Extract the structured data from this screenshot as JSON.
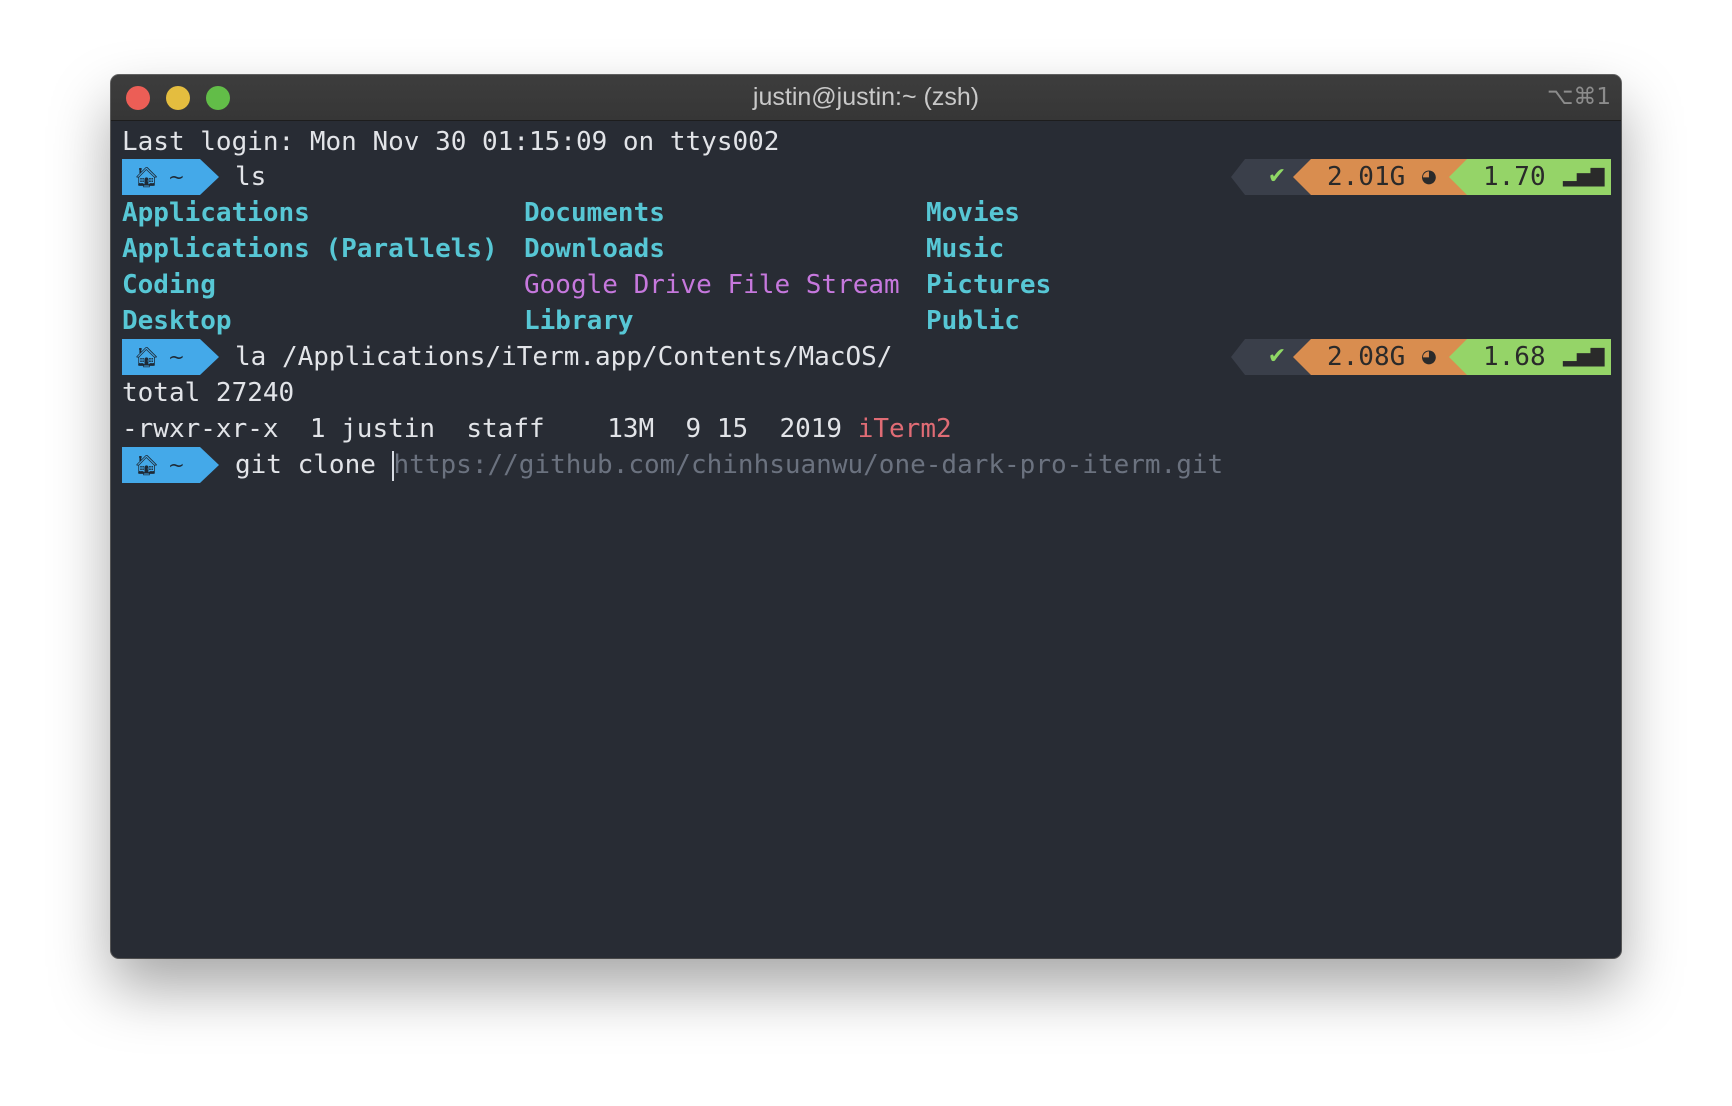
{
  "window": {
    "title": "justin@justin:~ (zsh)",
    "shortcut": "⌥⌘1"
  },
  "colors": {
    "background": "#282c34",
    "foreground": "#e2e4e8",
    "directory": "#57c7d5",
    "prompt": "#44a9e9",
    "memory_segment": "#d98d4f",
    "load_segment": "#95d468",
    "executable": "#e06c75",
    "symlink": "#c678dd"
  },
  "terminal": {
    "last_login": "Last login: Mon Nov 30 01:15:09 on ttys002",
    "prompt_home_icon": "house-icon",
    "prompt_dir": "~",
    "status_ok_icon": "check-icon",
    "ls": {
      "command": "ls",
      "memory": "2.01G",
      "load": "1.70",
      "columns": [
        [
          "Applications",
          "Applications (Parallels)",
          "Coding",
          "Desktop"
        ],
        [
          "Documents",
          "Downloads",
          "Google Drive File Stream",
          "Library"
        ],
        [
          "Movies",
          "Music",
          "Pictures",
          "Public"
        ]
      ]
    },
    "la": {
      "command": "la /Applications/iTerm.app/Contents/MacOS/",
      "memory": "2.08G",
      "load": "1.68",
      "total": "total 27240",
      "entry_prefix": "-rwxr-xr-x  1 justin  staff    13M  9 15  2019 ",
      "entry_name": "iTerm2"
    },
    "git": {
      "command": "git clone ",
      "suggestion": "https://github.com/chinhsuanwu/one-dark-pro-iterm.git"
    }
  }
}
